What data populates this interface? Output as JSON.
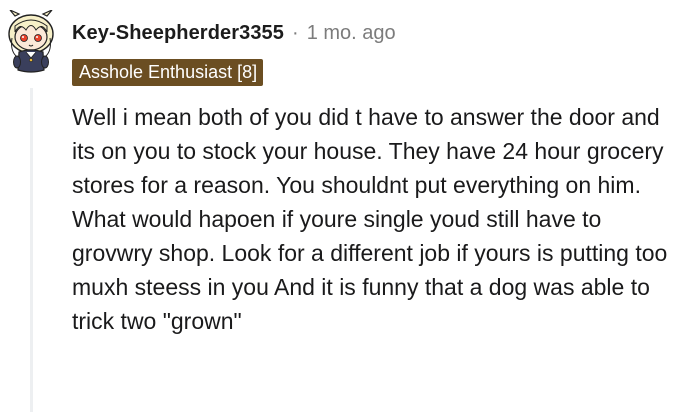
{
  "comment": {
    "username": "Key-Sheepherder3355",
    "separator": "·",
    "timestamp": "1 mo. ago",
    "flair": "Asshole Enthusiast [8]",
    "body": "Well i mean both of you did t have to answer the door and its on you to stock your house. They have 24 hour grocery stores for a reason. You shouldnt put everything on him. What would hapoen if youre single youd still have to grovwry shop. Look for a different job if yours is putting too muxh steess in you And it is funny that a dog was able to trick two \"grown\""
  },
  "avatar": {
    "icon": "snoo-avatar-icon",
    "colors": {
      "face": "#fbe9d8",
      "hair": "#f7f0c8",
      "outline": "#222222",
      "eyes": "#e8412b",
      "shirt": "#3a3f5c"
    }
  },
  "colors": {
    "flair_bg": "#6b4e22",
    "thread_line": "#edeff1",
    "meta_text": "#7c7c7c"
  }
}
